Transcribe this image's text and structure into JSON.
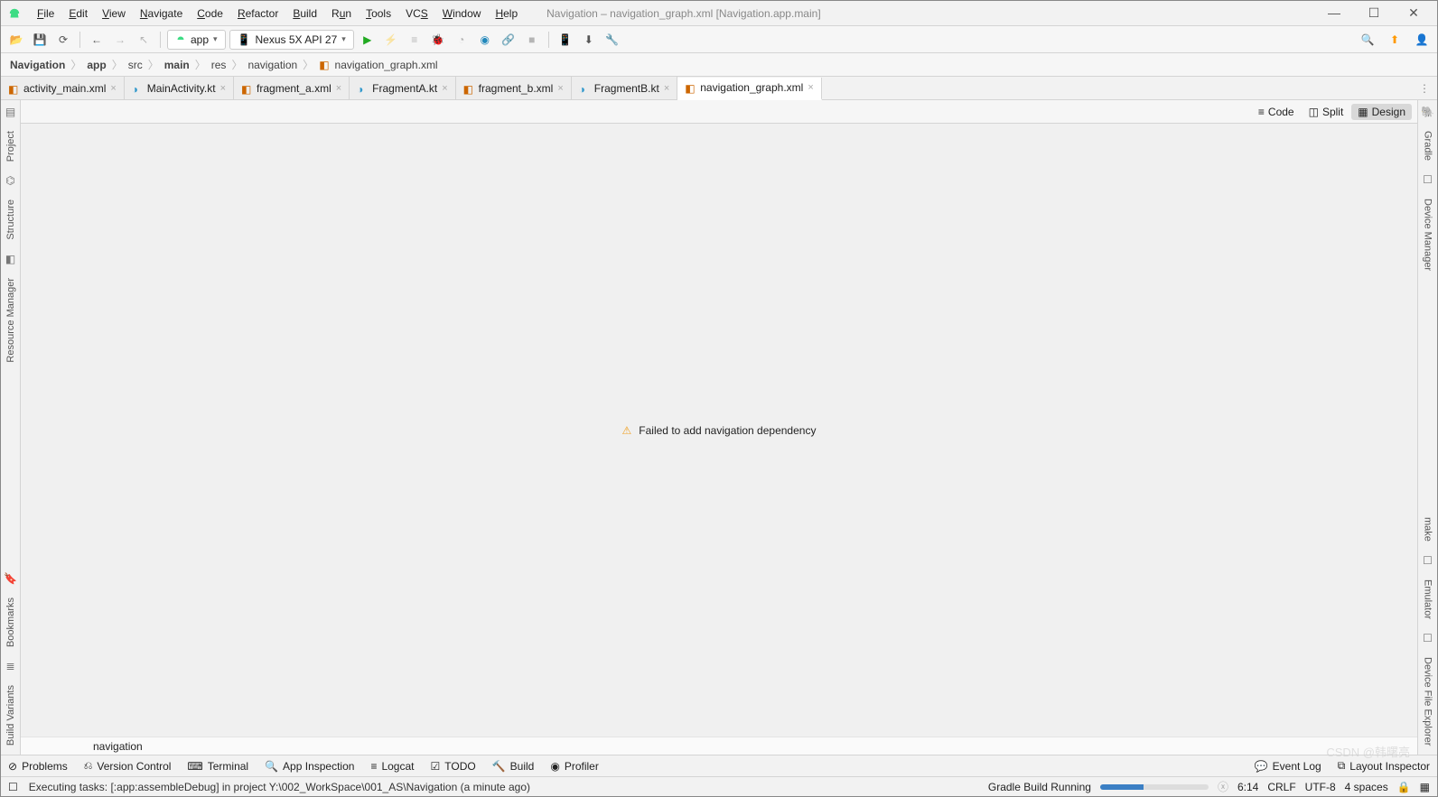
{
  "window": {
    "title": "Navigation – navigation_graph.xml [Navigation.app.main]"
  },
  "menu": {
    "file": "File",
    "edit": "Edit",
    "view": "View",
    "navigate": "Navigate",
    "code": "Code",
    "refactor": "Refactor",
    "build": "Build",
    "run": "Run",
    "tools": "Tools",
    "vcs": "VCS",
    "window": "Window",
    "help": "Help"
  },
  "toolbar": {
    "module": "app",
    "device": "Nexus 5X API 27"
  },
  "breadcrumbs": [
    "Navigation",
    "app",
    "src",
    "main",
    "res",
    "navigation",
    "navigation_graph.xml"
  ],
  "tabs": [
    {
      "label": "activity_main.xml"
    },
    {
      "label": "MainActivity.kt"
    },
    {
      "label": "fragment_a.xml"
    },
    {
      "label": "FragmentA.kt"
    },
    {
      "label": "fragment_b.xml"
    },
    {
      "label": "FragmentB.kt"
    },
    {
      "label": "navigation_graph.xml"
    }
  ],
  "view_modes": {
    "code": "Code",
    "split": "Split",
    "design": "Design"
  },
  "editor": {
    "message": "Failed to add navigation dependency",
    "bottom_hint": "navigation"
  },
  "left_tools": [
    "Project",
    "Structure",
    "Resource Manager",
    "Bookmarks",
    "Build Variants"
  ],
  "right_tools": [
    "Gradle",
    "Device Manager",
    "make",
    "Emulator",
    "Device File Explorer"
  ],
  "tool_windows": {
    "problems": "Problems",
    "vcs": "Version Control",
    "terminal": "Terminal",
    "app_inspection": "App Inspection",
    "logcat": "Logcat",
    "todo": "TODO",
    "build": "Build",
    "profiler": "Profiler",
    "event_log": "Event Log",
    "layout_inspector": "Layout Inspector"
  },
  "status": {
    "task": "Executing tasks: [:app:assembleDebug] in project Y:\\002_WorkSpace\\001_AS\\Navigation (a minute ago)",
    "gradle": "Gradle Build Running",
    "cursor": "6:14",
    "line_sep": "CRLF",
    "encoding": "UTF-8",
    "indent": "4 spaces"
  },
  "watermark": "CSDN @韩曙亮"
}
